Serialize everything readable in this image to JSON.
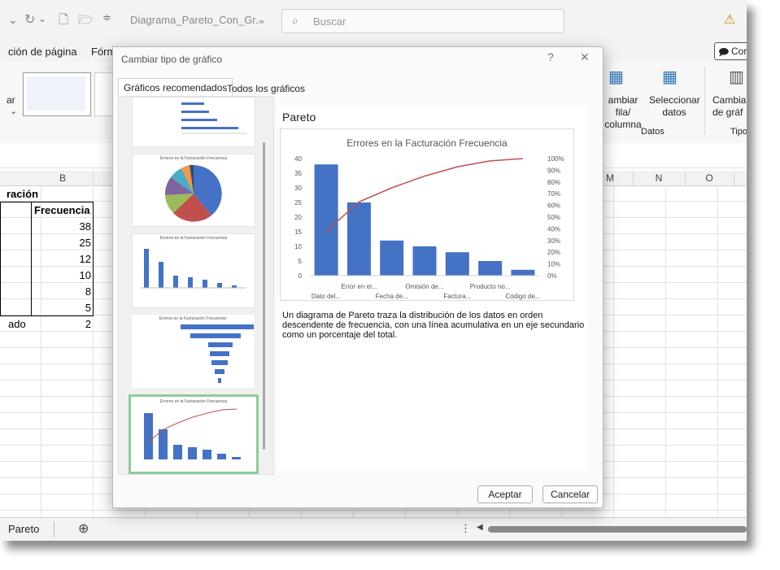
{
  "titlebar": {
    "file_name": "Diagrama_Pareto_Con_Gr...",
    "search_placeholder": "Buscar"
  },
  "ribbon_tabs": {
    "page_layout": "ción de página",
    "formulas": "Fórm",
    "comments": "Cor"
  },
  "ribbon": {
    "left_label": "ar",
    "switch_row_col": [
      "ambiar fila/",
      "columna"
    ],
    "select_data": [
      "Seleccionar",
      "datos"
    ],
    "change_type": [
      "Cambiar",
      "de gráf"
    ],
    "group_datos": "Datos",
    "group_tipo": "Tipo"
  },
  "sheet": {
    "columns": [
      "B",
      "M",
      "N",
      "O"
    ],
    "header_partial": "ración",
    "col_header": "Frecuencia",
    "values": [
      "38",
      "25",
      "12",
      "10",
      "8",
      "5",
      "2"
    ],
    "partial_label_last": "ado",
    "tab_name": "Pareto"
  },
  "dialog": {
    "title": "Cambiar tipo de gráfico",
    "help": "?",
    "close": "✕",
    "tabs": [
      "Gráficos recomendados",
      "Todos los gráficos"
    ],
    "selected_type": "Pareto",
    "description": [
      "Un diagrama de Pareto traza la distribución de los datos en orden",
      "descendente de frecuencia, con una línea acumulativa en un eje secundario",
      "como un porcentaje del total."
    ],
    "ok": "Aceptar",
    "cancel": "Cancelar"
  },
  "chart_data": {
    "type": "bar",
    "title": "Errores en la Facturación Frecuencia",
    "categories": [
      "Dato del...",
      "Error en el...",
      "Fecha de...",
      "Omisión de...",
      "Factura...",
      "Producto no...",
      "Código de..."
    ],
    "x_tick_labels_row1": [
      "Error en el...",
      "Omisión de...",
      "Producto no..."
    ],
    "x_tick_labels_row2": [
      "Dato del...",
      "Fecha de...",
      "Factura...",
      "Código de..."
    ],
    "series": [
      {
        "values": [
          38,
          25,
          12,
          10,
          8,
          5,
          2
        ]
      },
      {
        "values": [
          38,
          63,
          75,
          85,
          93,
          98,
          100
        ],
        "axis": "secondary"
      }
    ],
    "ylim": [
      0,
      40
    ],
    "y_ticks": [
      "0",
      "5",
      "10",
      "15",
      "20",
      "25",
      "30",
      "35",
      "40"
    ],
    "y2lim": [
      0,
      100
    ],
    "y2_ticks": [
      "0%",
      "10%",
      "20%",
      "30%",
      "40%",
      "50%",
      "60%",
      "70%",
      "80%",
      "90%",
      "100%"
    ],
    "colors": {
      "bars": "#4472c4",
      "line": "#c0504d"
    }
  },
  "thumbnails": {
    "pie_title": "Errores en la Facturación Frecuencia",
    "col_title": "Errores en la Facturación Frecuencia",
    "funnel_title": "Errores en la Facturación Frecuencia",
    "pareto_title": "Errores en la Facturación Frecuencia"
  }
}
